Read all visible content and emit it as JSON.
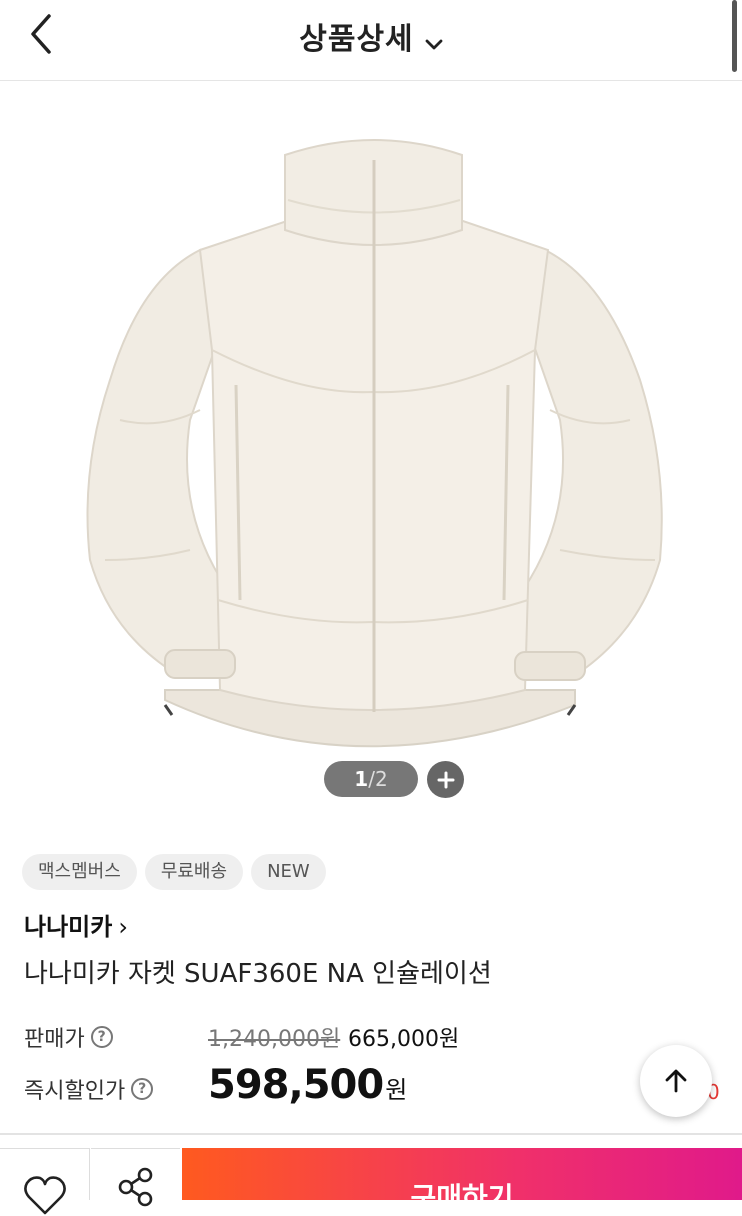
{
  "header": {
    "title": "상품상세"
  },
  "gallery": {
    "current": "1",
    "separator": "/",
    "total": "2"
  },
  "tags": [
    "맥스멤버스",
    "무료배송",
    "NEW"
  ],
  "brand": {
    "name": "나나미카",
    "chevron": "›"
  },
  "product": {
    "name": "나나미카 자켓 SUAF360E NA 인슐레이션"
  },
  "price": {
    "sale_label": "판매가",
    "original": "1,240,000원",
    "sale": "665,000원",
    "instant_label": "즉시할인가",
    "instant_value": "598,500",
    "instant_unit": "원",
    "help_glyph": "?",
    "trailing_char": "0"
  },
  "bottom_bar": {
    "buy_label": "구매하기"
  },
  "colors": {
    "buy_start": "#ff5a1f",
    "buy_end": "#e01a8a",
    "accent_red": "#e53935"
  },
  "icons": [
    "back-icon",
    "chevron-down-icon",
    "plus-icon",
    "help-icon",
    "arrow-up-icon",
    "heart-icon",
    "share-icon"
  ]
}
